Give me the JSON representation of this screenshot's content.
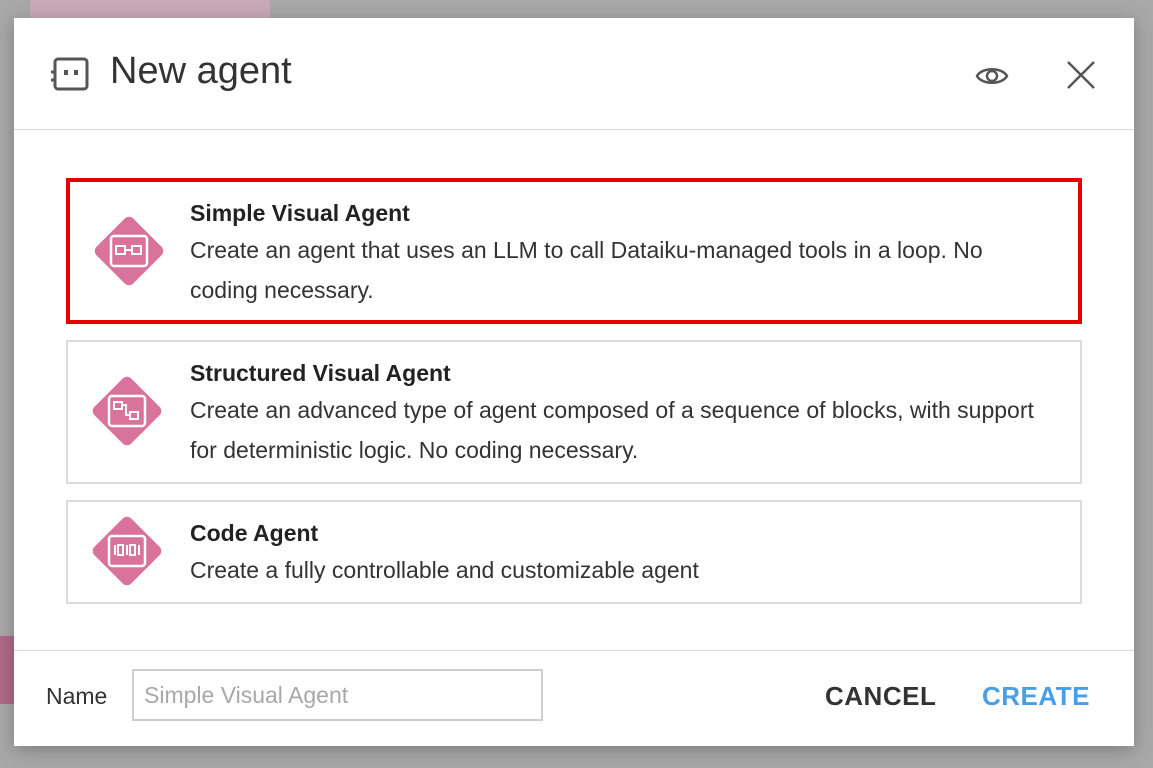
{
  "modal": {
    "title": "New agent",
    "header_icon": "agent-robot-icon",
    "eye_icon": "eye-icon",
    "close_icon": "close-icon"
  },
  "options": [
    {
      "title": "Simple Visual Agent",
      "description": "Create an agent that uses an LLM to call Dataiku-managed tools in a loop. No coding necessary.",
      "icon": "simple-agent-icon",
      "selected": true
    },
    {
      "title": "Structured Visual Agent",
      "description": "Create an advanced type of agent composed of a sequence of blocks, with support for deterministic logic. No coding necessary.",
      "icon": "structured-agent-icon",
      "selected": false
    },
    {
      "title": "Code Agent",
      "description": "Create a fully controllable and customizable agent",
      "icon": "code-agent-icon",
      "selected": false
    }
  ],
  "footer": {
    "name_label": "Name",
    "name_value": "",
    "name_placeholder": "Simple Visual Agent",
    "cancel_label": "CANCEL",
    "create_label": "CREATE"
  },
  "colors": {
    "icon_pink": "#d9739c",
    "selected_border": "#e60000",
    "create_blue": "#4a9ee6"
  }
}
